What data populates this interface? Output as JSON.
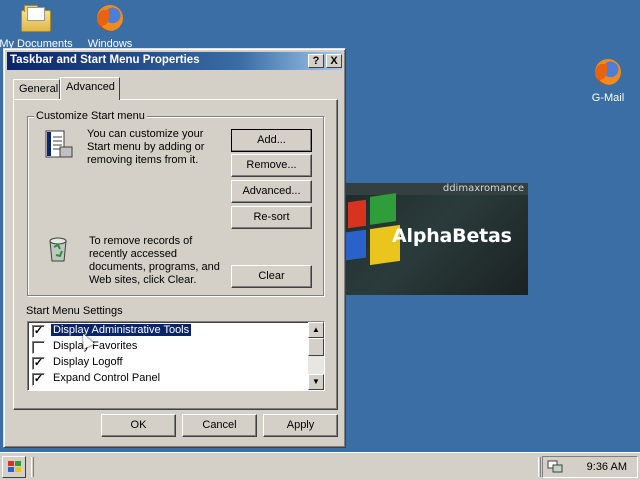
{
  "desktop": {
    "icons": [
      {
        "label": "My Documents",
        "icon": "folder-icon"
      },
      {
        "label": "Windows",
        "icon": "firefox-icon"
      },
      {
        "label": "G-Mail",
        "icon": "firefox-icon"
      }
    ],
    "banner": {
      "tag": "ddimaxromance",
      "title": "AlphaBetas"
    }
  },
  "dialog": {
    "title": "Taskbar and Start Menu Properties",
    "help_btn": "?",
    "close_btn": "X",
    "tabs": [
      {
        "label": "General"
      },
      {
        "label": "Advanced"
      }
    ],
    "active_tab": "Advanced",
    "customize_group": {
      "label": "Customize Start menu",
      "text": "You can customize your Start menu by adding or removing items from it.",
      "buttons": {
        "add": "Add...",
        "remove": "Remove...",
        "advanced": "Advanced...",
        "resort": "Re-sort"
      },
      "clear_text": "To remove records of recently accessed documents, programs, and Web sites,  click Clear.",
      "clear_button": "Clear"
    },
    "settings": {
      "label": "Start Menu Settings",
      "items": [
        {
          "label": "Display Administrative Tools",
          "checked": true,
          "selected": true
        },
        {
          "label": "Display Favorites",
          "checked": false,
          "selected": false
        },
        {
          "label": "Display Logoff",
          "checked": true,
          "selected": false
        },
        {
          "label": "Expand Control Panel",
          "checked": true,
          "selected": false
        }
      ]
    },
    "footer": {
      "ok": "OK",
      "cancel": "Cancel",
      "apply": "Apply"
    }
  },
  "taskbar": {
    "clock": "9:36 AM",
    "colors": {
      "desktop": "#3a6ea5",
      "title_start": "#0a246a",
      "selection": "#0a246a"
    }
  }
}
